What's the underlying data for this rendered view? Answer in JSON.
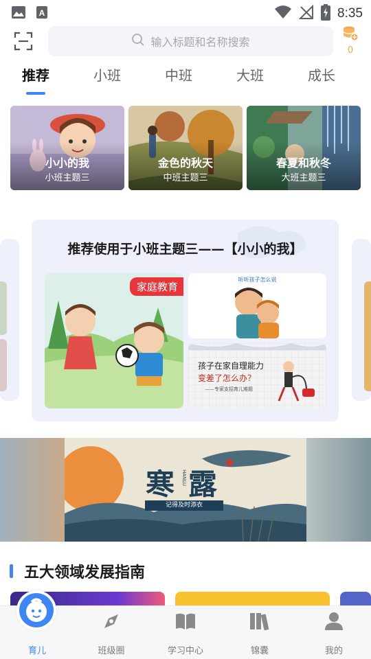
{
  "status_bar": {
    "time": "8:35",
    "icons": [
      "image-icon",
      "font-icon",
      "wifi-icon",
      "no-signal-icon",
      "battery-charging-icon"
    ]
  },
  "search": {
    "placeholder": "输入标题和名称搜索",
    "coin_count": "0"
  },
  "tabs": [
    {
      "label": "推荐",
      "active": true
    },
    {
      "label": "小班",
      "active": false
    },
    {
      "label": "中班",
      "active": false
    },
    {
      "label": "大班",
      "active": false
    },
    {
      "label": "成长",
      "active": false
    }
  ],
  "theme_cards": [
    {
      "title": "小小的我",
      "subtitle": "小班主题三"
    },
    {
      "title": "金色的秋天",
      "subtitle": "中班主题三"
    },
    {
      "title": "春夏和秋冬",
      "subtitle": "大班主题三"
    }
  ],
  "recommend": {
    "title": "推荐使用于小班主题三——【小小的我】",
    "badge": "家庭教育",
    "small1_caption": "听听孩子怎么说",
    "small2_line1": "孩子在家自理能力",
    "small2_line2": "变差了怎么办？",
    "small2_line3": "——专家支招育儿难题"
  },
  "banner": {
    "title": "寒露",
    "pinyin": "HANLU",
    "subtitle": "记得及时添衣"
  },
  "section": {
    "title": "五大领域发展指南"
  },
  "bottom_nav": [
    {
      "label": "育儿",
      "icon": "baby-face-icon",
      "active": true
    },
    {
      "label": "班级圈",
      "icon": "compass-icon",
      "active": false
    },
    {
      "label": "学习中心",
      "icon": "book-icon",
      "active": false
    },
    {
      "label": "锦囊",
      "icon": "books-icon",
      "active": false
    },
    {
      "label": "我的",
      "icon": "person-icon",
      "active": false
    }
  ],
  "colors": {
    "accent": "#3e86f5",
    "badge_red": "#e8343b",
    "coin": "#f3a64a",
    "panel_bg": "#eef1fb"
  }
}
